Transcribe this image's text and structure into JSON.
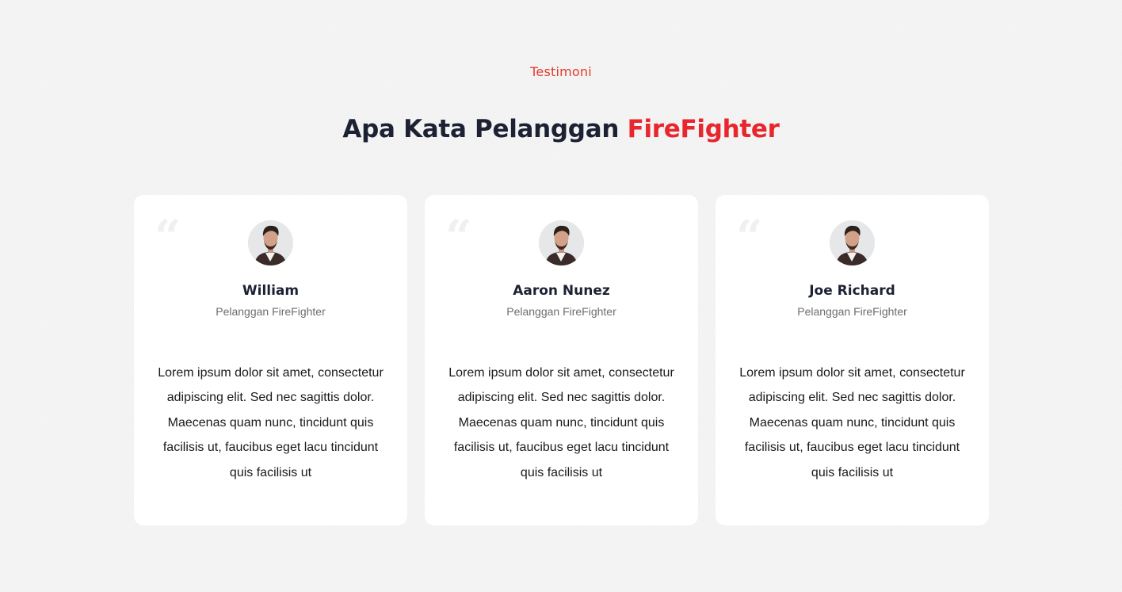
{
  "section": {
    "eyebrow": "Testimoni",
    "title_main": "Apa Kata Pelanggan ",
    "title_accent": "FireFighter"
  },
  "colors": {
    "accent": "#e8262d",
    "heading": "#1c2233",
    "background": "#f4f4f4",
    "card": "#ffffff"
  },
  "testimonials": [
    {
      "name": "William",
      "role": "Pelanggan FireFighter",
      "text": "Lorem ipsum dolor sit amet, consectetur adipiscing elit. Sed nec sagittis dolor. Maecenas quam nunc, tincidunt quis facilisis ut, faucibus eget lacu tincidunt quis facilisis ut",
      "quote_icon": "quote-mark-icon",
      "avatar_icon": "user-avatar"
    },
    {
      "name": "Aaron Nunez",
      "role": "Pelanggan FireFighter",
      "text": "Lorem ipsum dolor sit amet, consectetur adipiscing elit. Sed nec sagittis dolor. Maecenas quam nunc, tincidunt quis facilisis ut, faucibus eget lacu tincidunt quis facilisis ut",
      "quote_icon": "quote-mark-icon",
      "avatar_icon": "user-avatar"
    },
    {
      "name": "Joe Richard",
      "role": "Pelanggan FireFighter",
      "text": "Lorem ipsum dolor sit amet, consectetur adipiscing elit. Sed nec sagittis dolor. Maecenas quam nunc, tincidunt quis facilisis ut, faucibus eget lacu tincidunt quis facilisis ut",
      "quote_icon": "quote-mark-icon",
      "avatar_icon": "user-avatar"
    }
  ]
}
